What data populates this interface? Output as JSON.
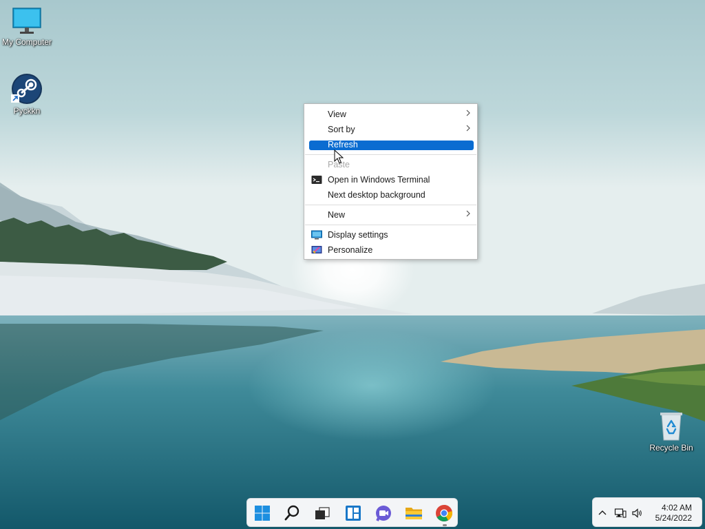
{
  "desktop": {
    "icons": [
      {
        "label": "My Computer",
        "icon": "monitor-icon"
      },
      {
        "label": "Pyckkn",
        "icon": "steam-icon"
      },
      {
        "label": "Recycle Bin",
        "icon": "recycle-bin-icon"
      }
    ]
  },
  "context_menu": {
    "items": [
      {
        "label": "View",
        "submenu": true
      },
      {
        "label": "Sort by",
        "submenu": true
      },
      {
        "label": "Refresh",
        "highlighted": true
      },
      {
        "label": "Paste",
        "disabled": true
      },
      {
        "label": "Open in Windows Terminal",
        "icon": "terminal-icon"
      },
      {
        "label": "Next desktop background"
      },
      {
        "label": "New",
        "submenu": true
      },
      {
        "label": "Display settings",
        "icon": "display-icon"
      },
      {
        "label": "Personalize",
        "icon": "personalize-icon"
      }
    ],
    "highlight_color": "#0a6cd1"
  },
  "taskbar": {
    "apps": [
      "start-icon",
      "search-icon",
      "task-view-icon",
      "widgets-icon",
      "chat-icon",
      "file-explorer-icon",
      "chrome-icon"
    ]
  },
  "tray": {
    "time": "4:02 AM",
    "date": "5/24/2022",
    "icons": [
      "chevron-up-icon",
      "network-icon",
      "volume-icon"
    ]
  }
}
